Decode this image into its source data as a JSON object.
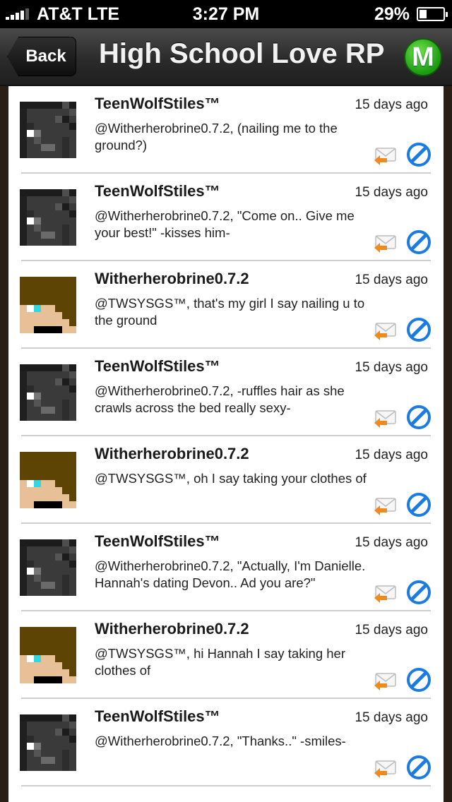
{
  "status": {
    "carrier": "AT&T  LTE",
    "time": "3:27 PM",
    "battery": "29%",
    "battery_level": 0.29
  },
  "nav": {
    "back_label": "Back",
    "title": "High School Love RP",
    "badge": "M"
  },
  "colors": {
    "accent_green": "#1d9a12",
    "block_blue": "#1a7be0",
    "reply_orange": "#f08a1e"
  },
  "posts": [
    {
      "avatar": "stiles",
      "username": "TeenWolfStiles™",
      "time": "15 days ago",
      "message": "@Witherherobrine0.7.2, (nailing me to the ground?)"
    },
    {
      "avatar": "stiles",
      "username": "TeenWolfStiles™",
      "time": "15 days ago",
      "message": "@Witherherobrine0.7.2, \"Come on.. Give me your best!\" -kisses him-"
    },
    {
      "avatar": "wither",
      "username": "Witherherobrine0.7.2",
      "time": "15 days ago",
      "message": "@TWSYSGS™, that's my girl I say nailing u to the ground"
    },
    {
      "avatar": "stiles",
      "username": "TeenWolfStiles™",
      "time": "15 days ago",
      "message": "@Witherherobrine0.7.2, -ruffles hair as she crawls across the bed really sexy-"
    },
    {
      "avatar": "wither",
      "username": "Witherherobrine0.7.2",
      "time": "15 days ago",
      "message": "@TWSYSGS™, oh I say taking your clothes of"
    },
    {
      "avatar": "stiles",
      "username": "TeenWolfStiles™",
      "time": "15 days ago",
      "message": "@Witherherobrine0.7.2, \"Actually, I'm Danielle. Hannah's dating Devon.. Ad you are?\""
    },
    {
      "avatar": "wither",
      "username": "Witherherobrine0.7.2",
      "time": "15 days ago",
      "message": "@TWSYSGS™, hi Hannah I say taking her clothes of"
    },
    {
      "avatar": "stiles",
      "username": "TeenWolfStiles™",
      "time": "15 days ago",
      "message": "@Witherherobrine0.7.2, \"Thanks..\" -smiles-"
    }
  ]
}
